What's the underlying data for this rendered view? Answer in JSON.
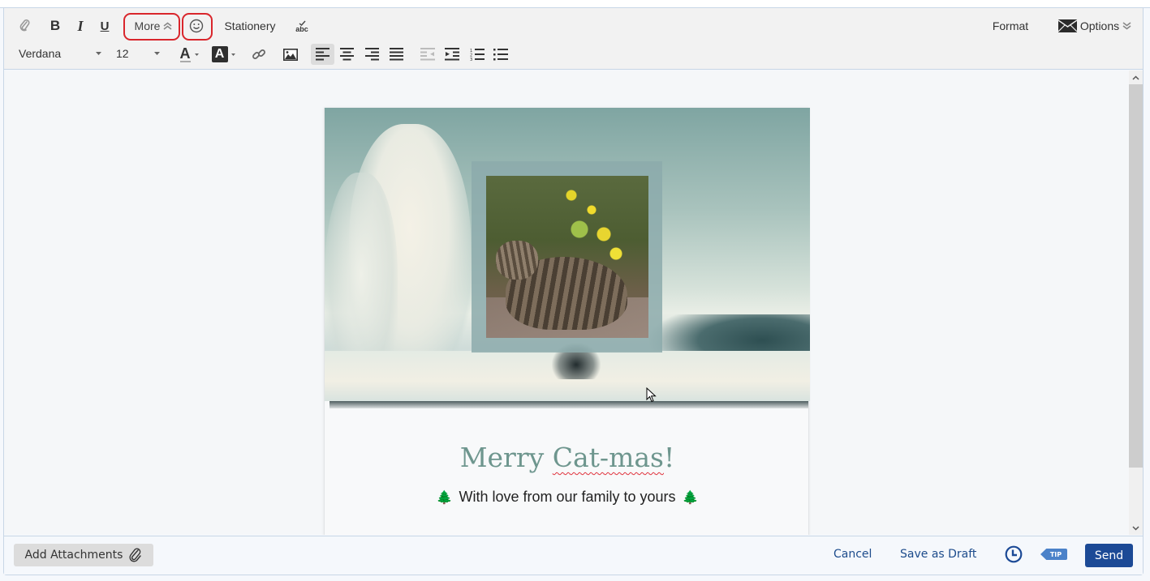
{
  "toolbar": {
    "row1": {
      "attach_icon": "paperclip-icon",
      "bold_label": "B",
      "italic_label": "I",
      "underline_label": "U",
      "more_label": "More",
      "more_icon": "double-chevron-up-icon",
      "emoji_icon": "smiley-icon",
      "stationery_label": "Stationery",
      "spellcheck_label": "abc",
      "format_label": "Format",
      "options_label": "Options",
      "options_icon": "envelope-icon"
    },
    "row2": {
      "font_family": "Verdana",
      "font_size": "12",
      "text_color_label": "A",
      "highlight_label": "A",
      "alignment_active": "left"
    },
    "highlight_color": "#d9262c"
  },
  "message": {
    "greeting_prefix": "Merry ",
    "greeting_misspelled": "Cat-mas",
    "greeting_suffix": "!",
    "subline": "With love from our family to yours",
    "subline_emoji": "🌲",
    "greeting_color": "#6e968e"
  },
  "footer": {
    "add_attachments_label": "Add Attachments",
    "cancel_label": "Cancel",
    "save_draft_label": "Save as Draft",
    "tip_label": "TIP",
    "send_label": "Send",
    "send_color": "#1c4a96"
  }
}
